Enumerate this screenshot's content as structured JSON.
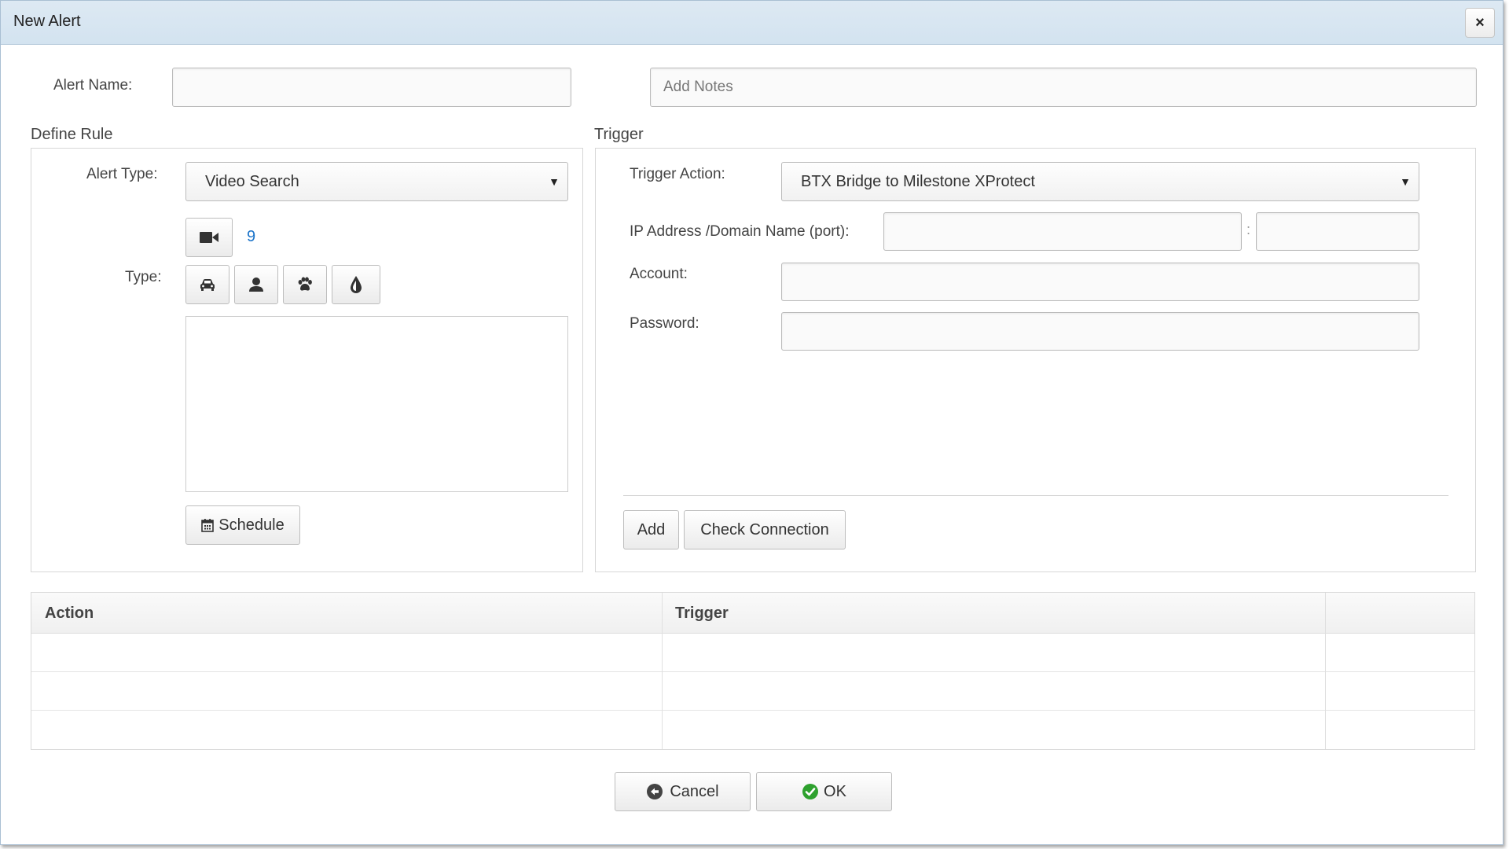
{
  "dialog": {
    "title": "New Alert",
    "close_label": "×"
  },
  "alert_name": {
    "label": "Alert Name:",
    "value": ""
  },
  "notes": {
    "placeholder": "Add Notes",
    "value": ""
  },
  "define_rule": {
    "section_label": "Define Rule",
    "alert_type_label": "Alert Type:",
    "alert_type_value": "Video Search",
    "camera_count": "9",
    "type_label": "Type:",
    "type_buttons": [
      {
        "icon": "car-icon"
      },
      {
        "icon": "person-icon"
      },
      {
        "icon": "paw-icon"
      },
      {
        "icon": "drop-icon"
      }
    ],
    "schedule_label": "Schedule"
  },
  "trigger": {
    "section_label": "Trigger",
    "trigger_action_label": "Trigger Action:",
    "trigger_action_value": "BTX Bridge to Milestone XProtect",
    "ip_label": "IP Address /Domain Name (port):",
    "ip_separator": ":",
    "ip_value": "",
    "port_value": "",
    "account_label": "Account:",
    "account_value": "",
    "password_label": "Password:",
    "password_value": "",
    "add_label": "Add",
    "check_connection_label": "Check Connection"
  },
  "table": {
    "columns": [
      "Action",
      "Trigger",
      ""
    ],
    "rows": [
      [
        "",
        "",
        ""
      ],
      [
        "",
        "",
        ""
      ],
      [
        "",
        "",
        ""
      ]
    ]
  },
  "footer": {
    "cancel_label": "Cancel",
    "ok_label": "OK"
  },
  "colors": {
    "camera_count": "#1a73c9",
    "ok_icon": "#2ea12e",
    "cancel_icon": "#444444"
  }
}
